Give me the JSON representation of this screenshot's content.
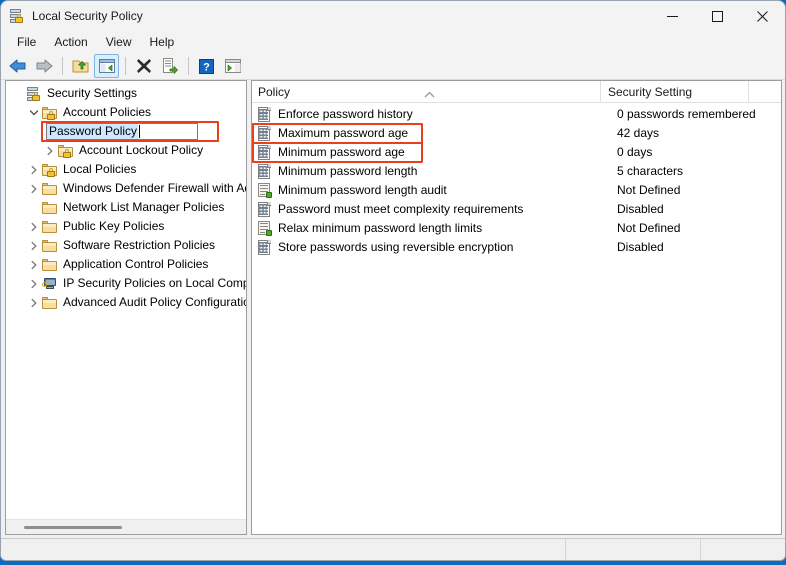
{
  "window": {
    "title": "Local Security Policy",
    "app_icon": "security-policy-icon",
    "controls": {
      "minimize": "minimize-icon",
      "maximize": "maximize-icon",
      "close": "close-icon"
    }
  },
  "menubar": {
    "items": [
      "File",
      "Action",
      "View",
      "Help"
    ]
  },
  "toolbar": {
    "buttons": [
      {
        "name": "back-icon",
        "label": "Back"
      },
      {
        "name": "forward-icon",
        "label": "Forward"
      },
      {
        "name": "up-one-level-icon",
        "label": "Up One Level"
      },
      {
        "name": "show-hide-console-tree-icon",
        "label": "Show/Hide Console Tree",
        "pressed": true
      },
      {
        "name": "delete-icon",
        "label": "Delete"
      },
      {
        "name": "export-list-icon",
        "label": "Export List"
      },
      {
        "name": "help-icon",
        "label": "Help"
      },
      {
        "name": "show-hide-action-pane-icon",
        "label": "Show/Hide Action Pane"
      }
    ]
  },
  "tree": {
    "nodes": [
      {
        "label": "Security Settings",
        "indent": 0,
        "chevron": "none",
        "icon": "server-lock-icon"
      },
      {
        "label": "Account Policies",
        "indent": 1,
        "chevron": "expanded",
        "icon": "folder-lock-icon"
      },
      {
        "label": "Password Policy",
        "indent": 2,
        "chevron": "collapsed",
        "icon": "folder-lock-icon",
        "renaming": true,
        "highlighted": true
      },
      {
        "label": "Account Lockout Policy",
        "indent": 2,
        "chevron": "collapsed",
        "icon": "folder-lock-icon"
      },
      {
        "label": "Local Policies",
        "indent": 1,
        "chevron": "collapsed",
        "icon": "folder-lock-icon"
      },
      {
        "label": "Windows Defender Firewall with Adva",
        "indent": 1,
        "chevron": "collapsed",
        "icon": "folder-icon"
      },
      {
        "label": "Network List Manager Policies",
        "indent": 1,
        "chevron": "none",
        "icon": "folder-icon"
      },
      {
        "label": "Public Key Policies",
        "indent": 1,
        "chevron": "collapsed",
        "icon": "folder-icon"
      },
      {
        "label": "Software Restriction Policies",
        "indent": 1,
        "chevron": "collapsed",
        "icon": "folder-icon"
      },
      {
        "label": "Application Control Policies",
        "indent": 1,
        "chevron": "collapsed",
        "icon": "folder-icon"
      },
      {
        "label": "IP Security Policies on Local Compute",
        "indent": 1,
        "chevron": "collapsed",
        "icon": "computer-key-icon"
      },
      {
        "label": "Advanced Audit Policy Configuration",
        "indent": 1,
        "chevron": "collapsed",
        "icon": "folder-icon"
      }
    ]
  },
  "list": {
    "columns": [
      "Policy",
      "Security Setting",
      ""
    ],
    "sort_indicator": "ascending-caret-icon",
    "rows": [
      {
        "policy": "Enforce password history",
        "setting": "0 passwords remembered",
        "icon": "policy-doc-icon",
        "highlighted": false
      },
      {
        "policy": "Maximum password age",
        "setting": "42 days",
        "icon": "policy-doc-icon",
        "highlighted": true
      },
      {
        "policy": "Minimum password age",
        "setting": "0 days",
        "icon": "policy-doc-icon",
        "highlighted": true
      },
      {
        "policy": "Minimum password length",
        "setting": "5 characters",
        "icon": "policy-doc-icon",
        "highlighted": false
      },
      {
        "policy": "Minimum password length audit",
        "setting": "Not Defined",
        "icon": "policy-audit-icon",
        "highlighted": false
      },
      {
        "policy": "Password must meet complexity requirements",
        "setting": "Disabled",
        "icon": "policy-doc-icon",
        "highlighted": false
      },
      {
        "policy": "Relax minimum password length limits",
        "setting": "Not Defined",
        "icon": "policy-audit-icon",
        "highlighted": false
      },
      {
        "policy": "Store passwords using reversible encryption",
        "setting": "Disabled",
        "icon": "policy-doc-icon",
        "highlighted": false
      }
    ]
  },
  "statusbar": {
    "segments": [
      "",
      "",
      ""
    ]
  },
  "colors": {
    "highlight_box": "#e8401f",
    "selection": "#cde8ff",
    "accent": "#0f6cbd"
  }
}
